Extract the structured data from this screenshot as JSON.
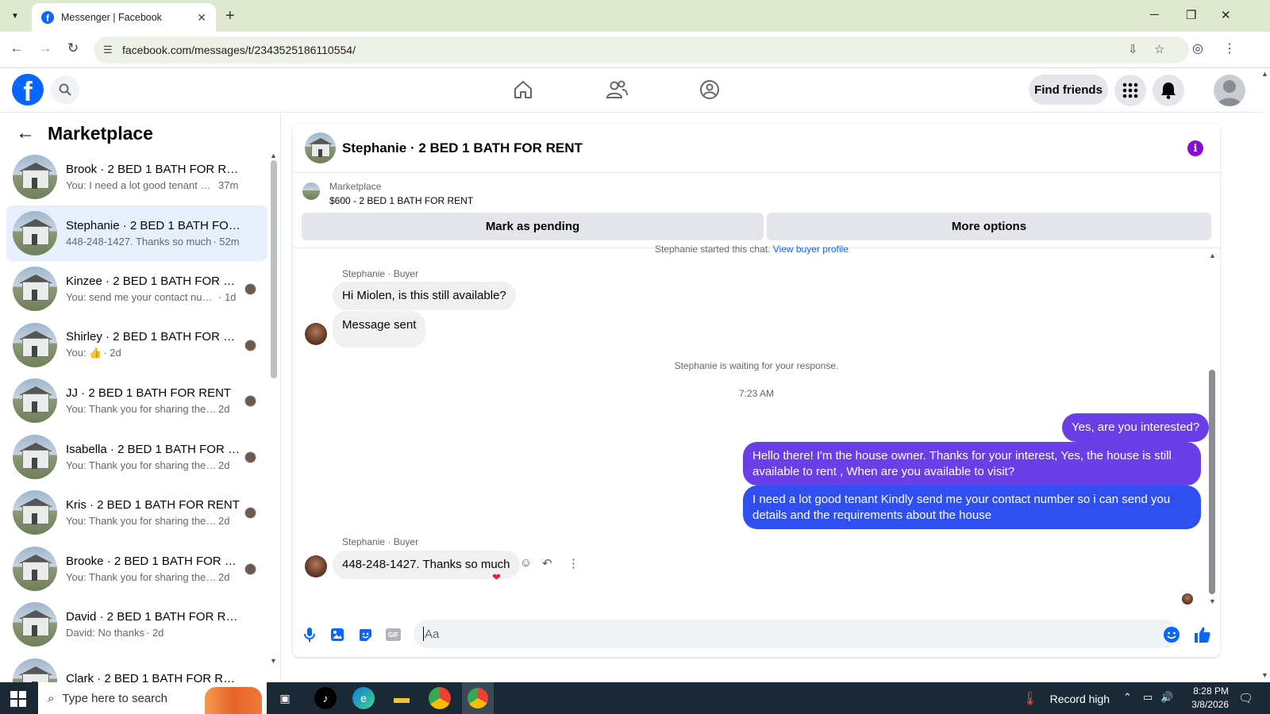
{
  "browser": {
    "tab_title": "Messenger | Facebook",
    "url": "facebook.com/messages/t/2343525186110554/"
  },
  "fb_header": {
    "find_friends": "Find friends"
  },
  "sidebar": {
    "title": "Marketplace",
    "conversations": [
      {
        "title": "Brook · 2 BED 1 BATH FOR RENT",
        "snippet": "You: I need a lot good tenant Kin...",
        "time": "37m",
        "active": false,
        "seen": false
      },
      {
        "title": "Stephanie · 2 BED 1 BATH FOR R...",
        "snippet": "448-248-1427. Thanks so much",
        "time": "· 52m",
        "active": true,
        "seen": false
      },
      {
        "title": "Kinzee · 2 BED 1 BATH FOR RE...",
        "snippet": "You: send me your contact num...",
        "time": "· 1d",
        "active": false,
        "seen": true
      },
      {
        "title": "Shirley · 2 BED 1 BATH FOR RE...",
        "snippet": "You: 👍",
        "time": "· 2d",
        "active": false,
        "seen": true
      },
      {
        "title": "JJ · 2 BED 1 BATH FOR RENT",
        "snippet": "You: Thank you for sharing the s...",
        "time": "2d",
        "active": false,
        "seen": true
      },
      {
        "title": "Isabella · 2 BED 1 BATH FOR R...",
        "snippet": "You: Thank you for sharing the s...",
        "time": "2d",
        "active": false,
        "seen": true
      },
      {
        "title": "Kris · 2 BED 1 BATH FOR RENT",
        "snippet": "You: Thank you for sharing the s...",
        "time": "2d",
        "active": false,
        "seen": true
      },
      {
        "title": "Brooke · 2 BED 1 BATH FOR R...",
        "snippet": "You: Thank you for sharing the s...",
        "time": "2d",
        "active": false,
        "seen": true
      },
      {
        "title": "David · 2 BED 1 BATH FOR RENT",
        "snippet": "David: No thanks",
        "time": "· 2d",
        "active": false,
        "seen": false
      },
      {
        "title": "Clark · 2 BED 1 BATH FOR RENT",
        "snippet": "",
        "time": "",
        "active": false,
        "seen": false
      }
    ]
  },
  "chat": {
    "header_name": "Stephanie · 2 BED 1 BATH FOR RENT",
    "marketplace_label": "Marketplace",
    "listing": "$600 - 2 BED 1 BATH FOR RENT",
    "mark_pending": "Mark as pending",
    "more_options": "More options",
    "started_text": "Stephanie started this chat.",
    "view_buyer_profile": "View buyer profile",
    "sender_label": "Stephanie · Buyer",
    "msg_in_1": "Hi Miolen, is this still available?",
    "msg_in_2": "Message sent",
    "waiting": "Stephanie is waiting for your response.",
    "timestamp": "7:23 AM",
    "msg_out_1": "Yes, are you interested?",
    "msg_out_2": "Hello there! I'm the house owner. Thanks for your interest, Yes, the house is still available to rent , When are you available to visit?",
    "msg_out_3": "I need a lot good tenant Kindly send me your contact number so i can send you details and the requirements about the house",
    "msg_in_3": "448-248-1427. Thanks so much",
    "composer_placeholder": "Aa"
  },
  "taskbar": {
    "search_placeholder": "Type here to search",
    "weather": "Record high",
    "time": "8:28 PM",
    "date": "3/8/2026"
  },
  "colors": {
    "fb_blue": "#0866ff",
    "out_bubble_purple": "#6a3fe8",
    "out_bubble_blue": "#2f4ff0",
    "active_conv": "#e6f0fd"
  }
}
